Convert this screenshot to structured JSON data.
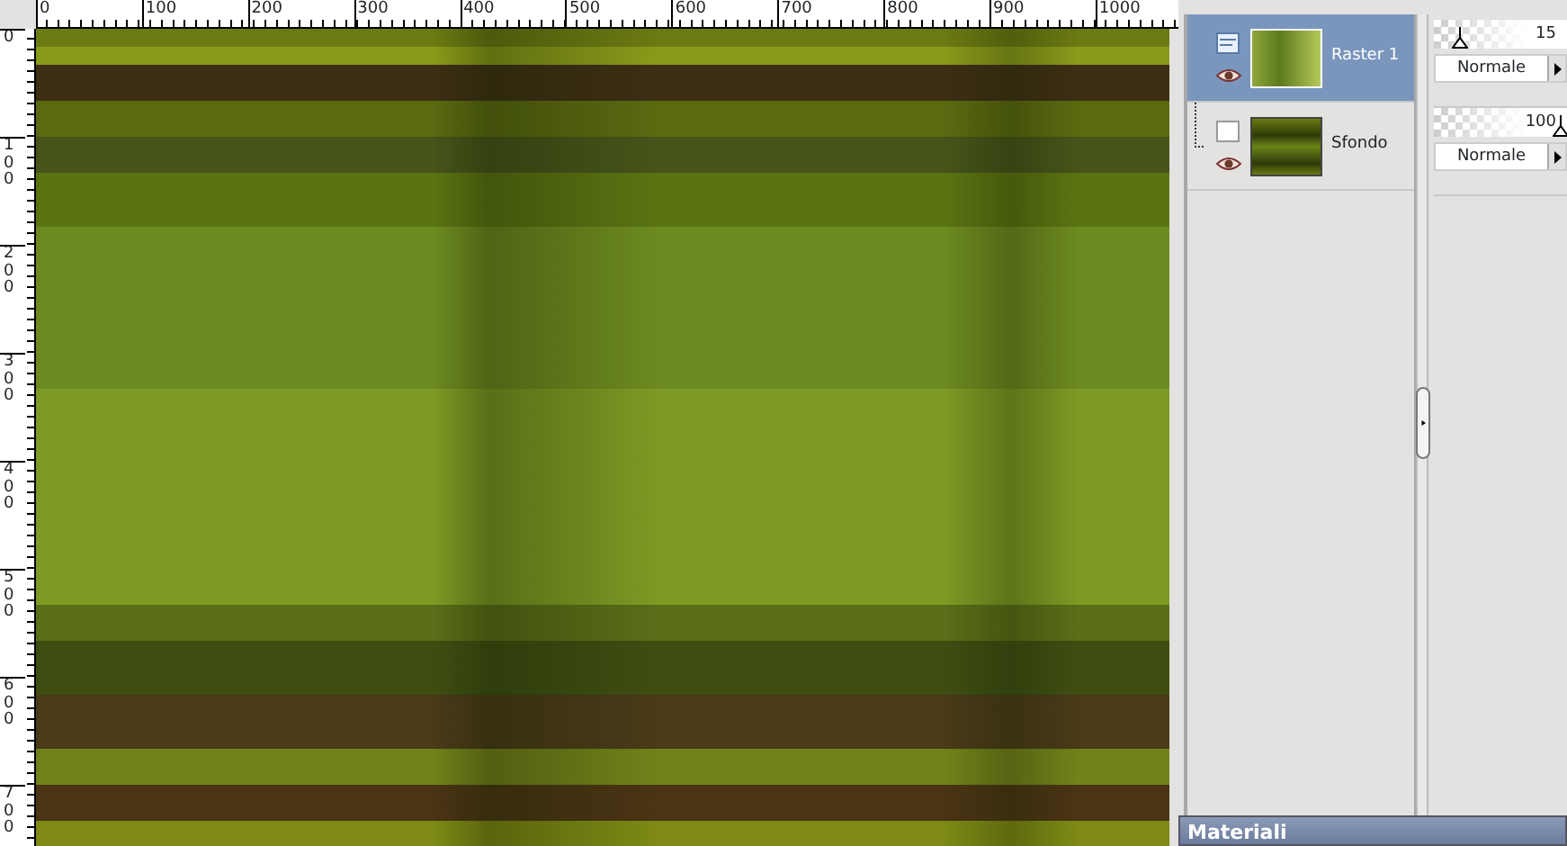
{
  "rulers": {
    "horizontal": [
      "0",
      "100",
      "200",
      "300",
      "400",
      "500",
      "600",
      "700",
      "800",
      "900",
      "1000"
    ],
    "vertical": [
      "0",
      "100",
      "200",
      "300",
      "400",
      "500",
      "600",
      "700"
    ]
  },
  "layers": [
    {
      "name": "Raster 1",
      "selected": true,
      "kind": "raster",
      "opacity": "15",
      "level": 0.15,
      "blend_mode": "Normale"
    },
    {
      "name": "Sfondo",
      "selected": false,
      "kind": "background",
      "opacity": "100",
      "level": 1.0,
      "blend_mode": "Normale"
    }
  ],
  "bottom_panel": {
    "title": "Materiali"
  }
}
